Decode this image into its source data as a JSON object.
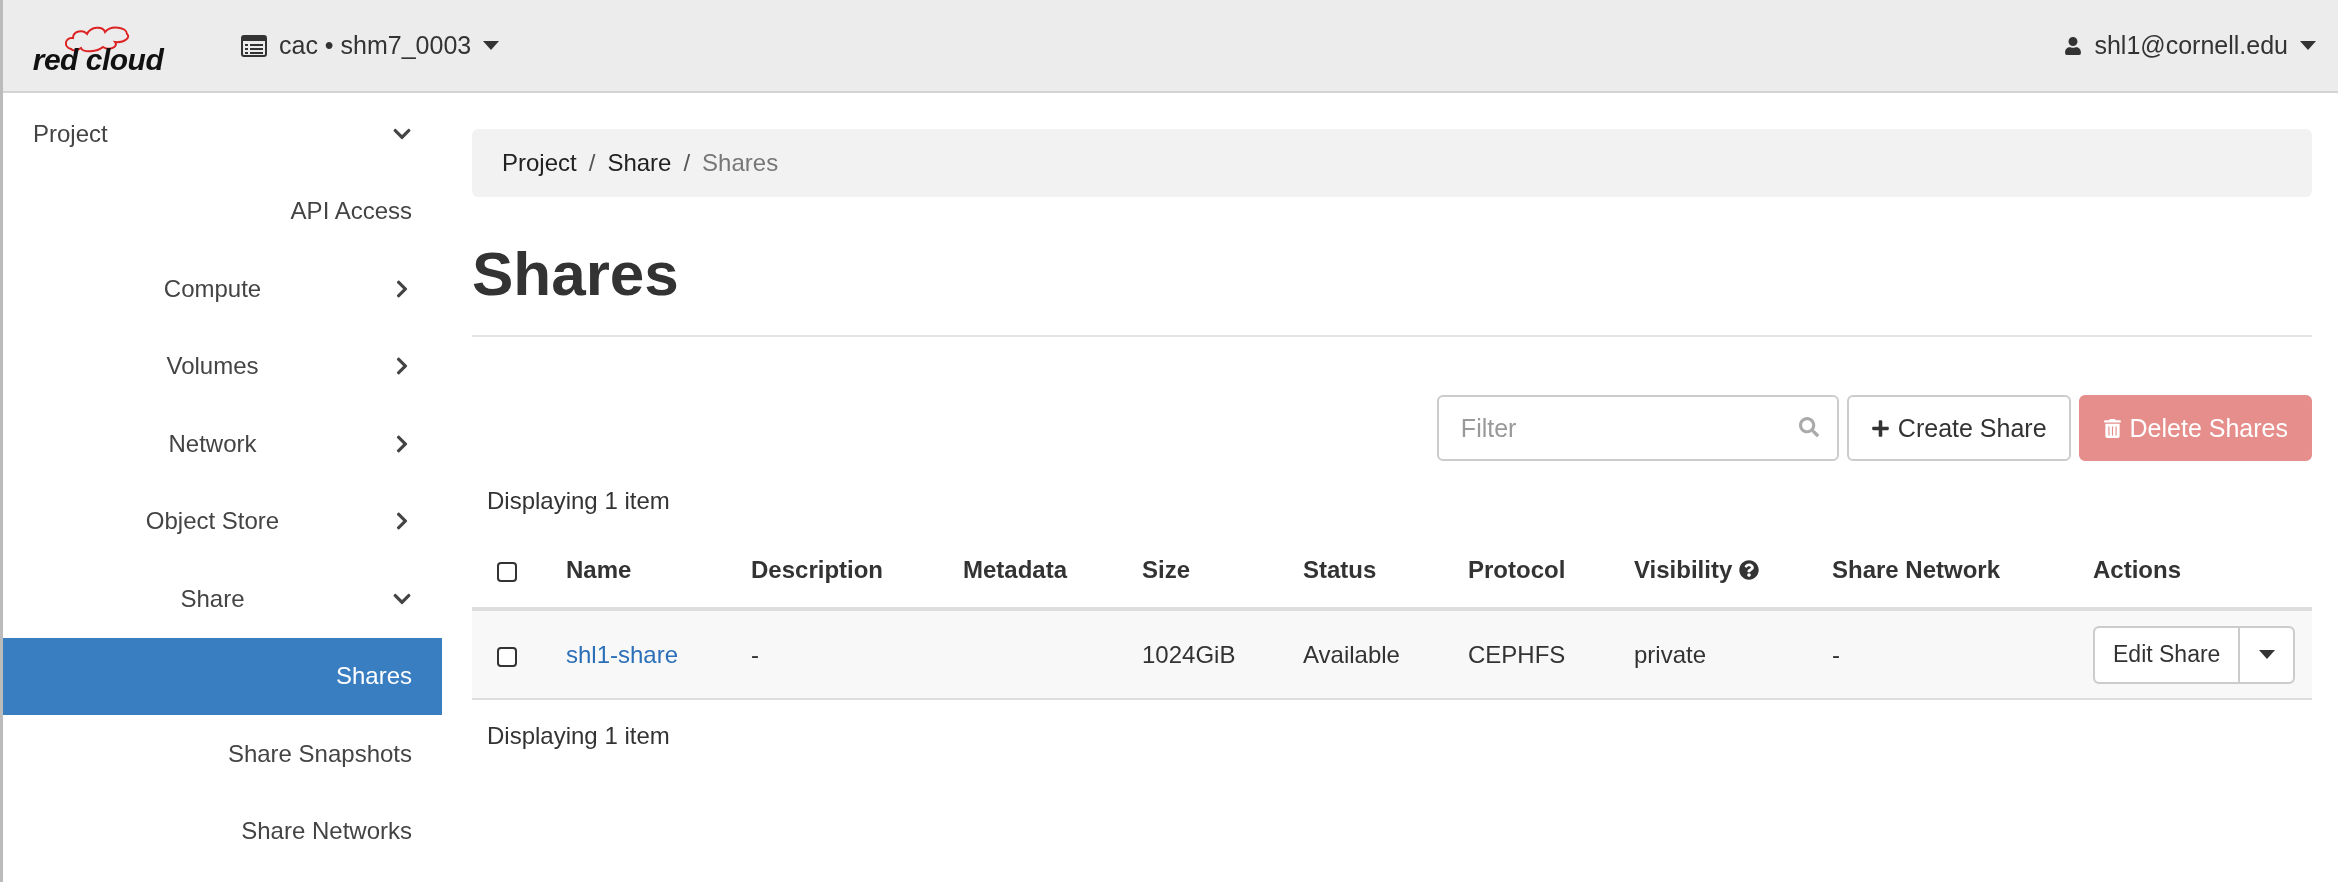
{
  "header": {
    "logo": "red cloud",
    "project_menu": "cac • shm7_0003",
    "user_menu": "shl1@cornell.edu"
  },
  "sidebar": {
    "items": [
      {
        "label": "Project",
        "kind": "group",
        "expanded": true,
        "children": [
          {
            "label": "API Access",
            "kind": "link",
            "selected": false
          },
          {
            "label": "Compute",
            "kind": "group",
            "expanded": false
          },
          {
            "label": "Volumes",
            "kind": "group",
            "expanded": false
          },
          {
            "label": "Network",
            "kind": "group",
            "expanded": false
          },
          {
            "label": "Object Store",
            "kind": "group",
            "expanded": false
          },
          {
            "label": "Share",
            "kind": "group",
            "expanded": true,
            "children": [
              {
                "label": "Shares",
                "kind": "link",
                "selected": true
              },
              {
                "label": "Share Snapshots",
                "kind": "link",
                "selected": false
              },
              {
                "label": "Share Networks",
                "kind": "link",
                "selected": false
              }
            ]
          }
        ]
      }
    ]
  },
  "breadcrumb": {
    "items": [
      "Project",
      "Share",
      "Shares"
    ],
    "separator": "/"
  },
  "page_title": "Shares",
  "toolbar": {
    "filter": {
      "placeholder": "Filter"
    },
    "buttons": [
      {
        "label": "Create Share",
        "kind": "create",
        "disabled": false
      },
      {
        "label": "Delete Shares",
        "kind": "delete",
        "disabled": true
      }
    ]
  },
  "table": {
    "summary_top": "Displaying 1 item",
    "select_all_checked": false,
    "columns": [
      {
        "label": "Name",
        "help": false
      },
      {
        "label": "Description",
        "help": false
      },
      {
        "label": "Metadata",
        "help": false
      },
      {
        "label": "Size",
        "help": false
      },
      {
        "label": "Status",
        "help": false
      },
      {
        "label": "Protocol",
        "help": false
      },
      {
        "label": "Visibility",
        "help": true
      },
      {
        "label": "Share Network",
        "help": false
      },
      {
        "label": "Actions",
        "help": false
      }
    ],
    "rows": [
      {
        "checked": false,
        "cells": [
          {
            "kind": "link",
            "text": "shl1-share"
          },
          {
            "kind": "text",
            "text": "-"
          },
          {
            "kind": "empty"
          },
          {
            "kind": "text",
            "text": "1024GiB"
          },
          {
            "kind": "text",
            "text": "Available"
          },
          {
            "kind": "text",
            "text": "CEPHFS"
          },
          {
            "kind": "text",
            "text": "private"
          },
          {
            "kind": "text",
            "text": "-"
          },
          {
            "kind": "action",
            "text": "Edit Share"
          }
        ]
      }
    ],
    "summary_bottom": "Displaying 1 item"
  }
}
